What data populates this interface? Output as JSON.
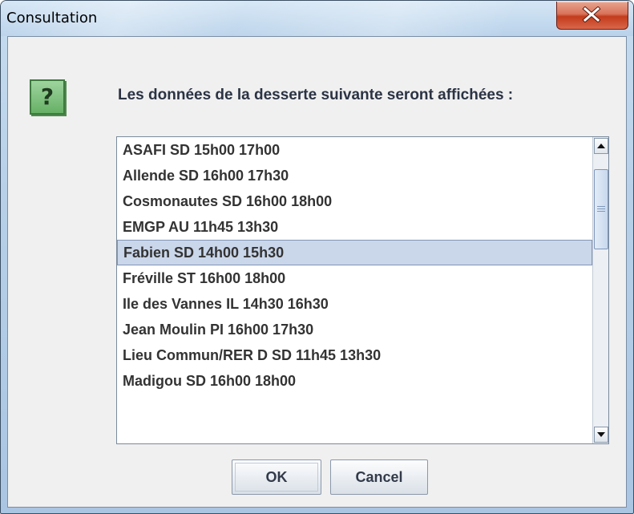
{
  "window": {
    "title": "Consultation"
  },
  "dialog": {
    "icon": "question-icon",
    "icon_glyph": "?",
    "message": "Les données de la desserte suivante seront affichées :",
    "selected_index": 4,
    "items": [
      "ASAFI SD 15h00 17h00",
      "Allende SD 16h00 17h30",
      "Cosmonautes SD 16h00 18h00",
      "EMGP AU 11h45 13h30",
      "Fabien SD 14h00 15h30",
      "Fréville ST 16h00 18h00",
      "Ile des Vannes IL 14h30 16h30",
      "Jean Moulin PI 16h00 17h30",
      "Lieu Commun/RER D SD 11h45 13h30",
      "Madigou SD 16h00 18h00"
    ],
    "ok_label": "OK",
    "cancel_label": "Cancel"
  },
  "colors": {
    "selection": "#cad6ea",
    "close_button": "#c23b1c",
    "icon_green": "#66b066"
  }
}
